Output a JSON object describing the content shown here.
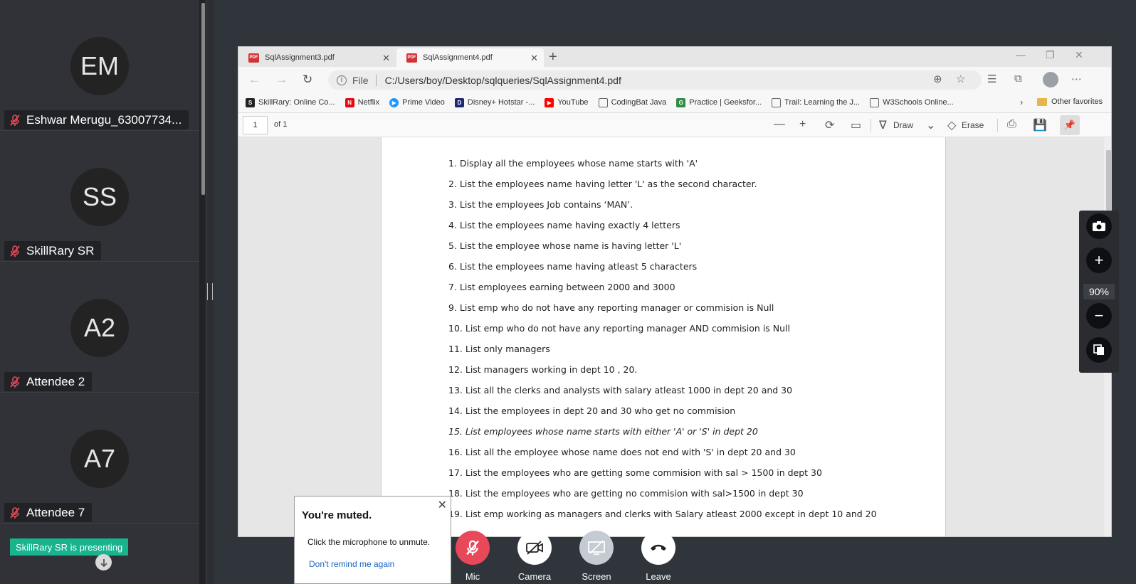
{
  "participants": [
    {
      "initials": "EM",
      "name": "Eshwar Merugu_63007734..."
    },
    {
      "initials": "SS",
      "name": "SkillRary SR"
    },
    {
      "initials": "A2",
      "name": "Attendee 2"
    },
    {
      "initials": "A7",
      "name": "Attendee 7"
    }
  ],
  "presenting_badge": "SkillRary SR is presenting",
  "browser": {
    "tabs": [
      {
        "label": "SqlAssignment3.pdf",
        "active": false
      },
      {
        "label": "SqlAssignment4.pdf",
        "active": true
      }
    ],
    "pdf_icon_text": "PDF",
    "address": {
      "info_icon": "i",
      "file_label": "File",
      "url": "C:/Users/boy/Desktop/sqlqueries/SqlAssignment4.pdf"
    },
    "favorites": [
      {
        "label": "SkillRary: Online Co...",
        "icon_color": "#222222",
        "icon_text": "S"
      },
      {
        "label": "Netflix",
        "icon_color": "#e50914",
        "icon_text": "N"
      },
      {
        "label": "Prime Video",
        "icon_color": "#1a98ff",
        "icon_text": "▶"
      },
      {
        "label": "Disney+ Hotstar -...",
        "icon_color": "#1f2a6e",
        "icon_text": "D"
      },
      {
        "label": "YouTube",
        "icon_color": "#ff0000",
        "icon_text": "▶"
      },
      {
        "label": "CodingBat Java",
        "icon_color": "#ffffff",
        "icon_text": ""
      },
      {
        "label": "Practice | Geeksfor...",
        "icon_color": "#2f8d46",
        "icon_text": "G"
      },
      {
        "label": "Trail: Learning the J...",
        "icon_color": "#ffffff",
        "icon_text": ""
      },
      {
        "label": "W3Schools Online...",
        "icon_color": "#ffffff",
        "icon_text": ""
      }
    ],
    "other_favorites": "Other favorites",
    "pdf_toolbar": {
      "page": "1",
      "page_total": "of 1",
      "draw_label": "Draw",
      "erase_label": "Erase"
    },
    "pdf_lines": [
      {
        "text": "1. Display all the employees whose name starts with 'A'",
        "italic": false
      },
      {
        "text": "2. List the employees name having letter 'L' as the second character.",
        "italic": false
      },
      {
        "text": "3. List the employees Job contains ‘MAN’.",
        "italic": false
      },
      {
        "text": "4. List the employees name having exactly 4 letters",
        "italic": false
      },
      {
        "text": "5. List the employee whose name is having letter 'L'",
        "italic": false
      },
      {
        "text": "6. List the employees name having atleast 5 characters",
        "italic": false
      },
      {
        "text": "7. List employees earning between 2000 and 3000",
        "italic": false
      },
      {
        "text": "9. List emp who do not have any reporting manager or commision is Null",
        "italic": false
      },
      {
        "text": "10. List emp who do not have any reporting manager AND commision is Null",
        "italic": false
      },
      {
        "text": "11. List only managers",
        "italic": false
      },
      {
        "text": "12. List managers working in dept 10 , 20.",
        "italic": false
      },
      {
        "text": "13. List all the clerks and analysts with salary atleast 1000 in dept 20 and 30",
        "italic": false
      },
      {
        "text": "14. List the employees in dept 20 and 30 who get no commision",
        "italic": false
      },
      {
        "text": "15. List employees whose name starts with either 'A' or 'S' in dept 20",
        "italic": true
      },
      {
        "text": "16. List all the employee whose name does not end with 'S' in dept 20 and 30",
        "italic": false
      },
      {
        "text": "17. List the employees who are getting some commision with sal > 1500 in dept 30",
        "italic": false
      },
      {
        "text": "18. List the employees who are getting no commision with sal>1500 in dept 30",
        "italic": false
      },
      {
        "text": "19. List emp working as managers and clerks with Salary atleast 2000 except in dept 10 and 20",
        "italic": false
      }
    ]
  },
  "zoom": {
    "level": "90%"
  },
  "toast": {
    "title": "You're muted.",
    "body": "Click the microphone to unmute.",
    "link": "Don't remind me again"
  },
  "controls": [
    {
      "label": "Mic",
      "name": "mic-button",
      "color": "#e8495a",
      "icon": "mic-off-icon"
    },
    {
      "label": "Camera",
      "name": "camera-button",
      "color": "#ffffff",
      "icon": "camera-off-icon"
    },
    {
      "label": "Screen",
      "name": "screen-share-button",
      "color": "#c5cbd3",
      "icon": "screen-share-icon"
    },
    {
      "label": "Leave",
      "name": "leave-button",
      "color": "#ffffff",
      "icon": "phone-hangup-icon"
    }
  ],
  "colors": {
    "accent": "#17b48e",
    "mic_off": "#e8495a"
  }
}
